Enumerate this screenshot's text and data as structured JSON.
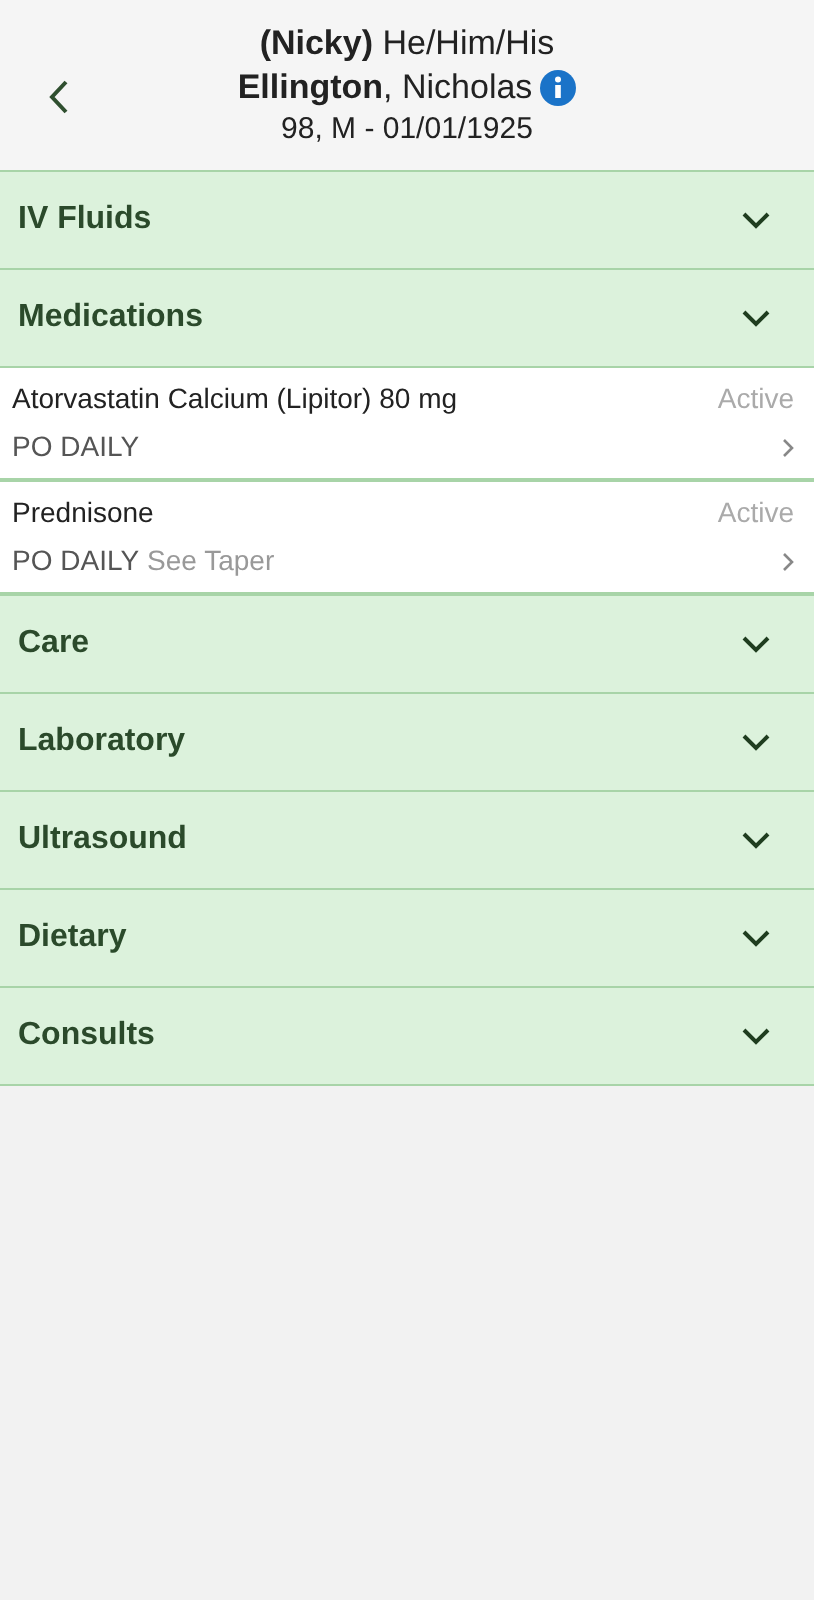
{
  "header": {
    "preferred": "**(Nicky)** He/Him/His",
    "name": "**Ellington**, Nicholas",
    "details": "98, M - 01/01/1925"
  },
  "sections": [
    {
      "title": "IV Fluids"
    },
    {
      "title": "Medications",
      "items": [
        {
          "name": "Atorvastatin Calcium (Lipitor) 80 mg",
          "status": "Active",
          "route": "PO DAILY"
        },
        {
          "name": "Prednisone",
          "status": "Active",
          "route": "PO DAILY",
          "note": "See Taper"
        }
      ]
    },
    {
      "title": "Care"
    },
    {
      "title": "Laboratory"
    },
    {
      "title": "Ultrasound"
    },
    {
      "title": "Dietary"
    },
    {
      "title": "Consults"
    }
  ]
}
